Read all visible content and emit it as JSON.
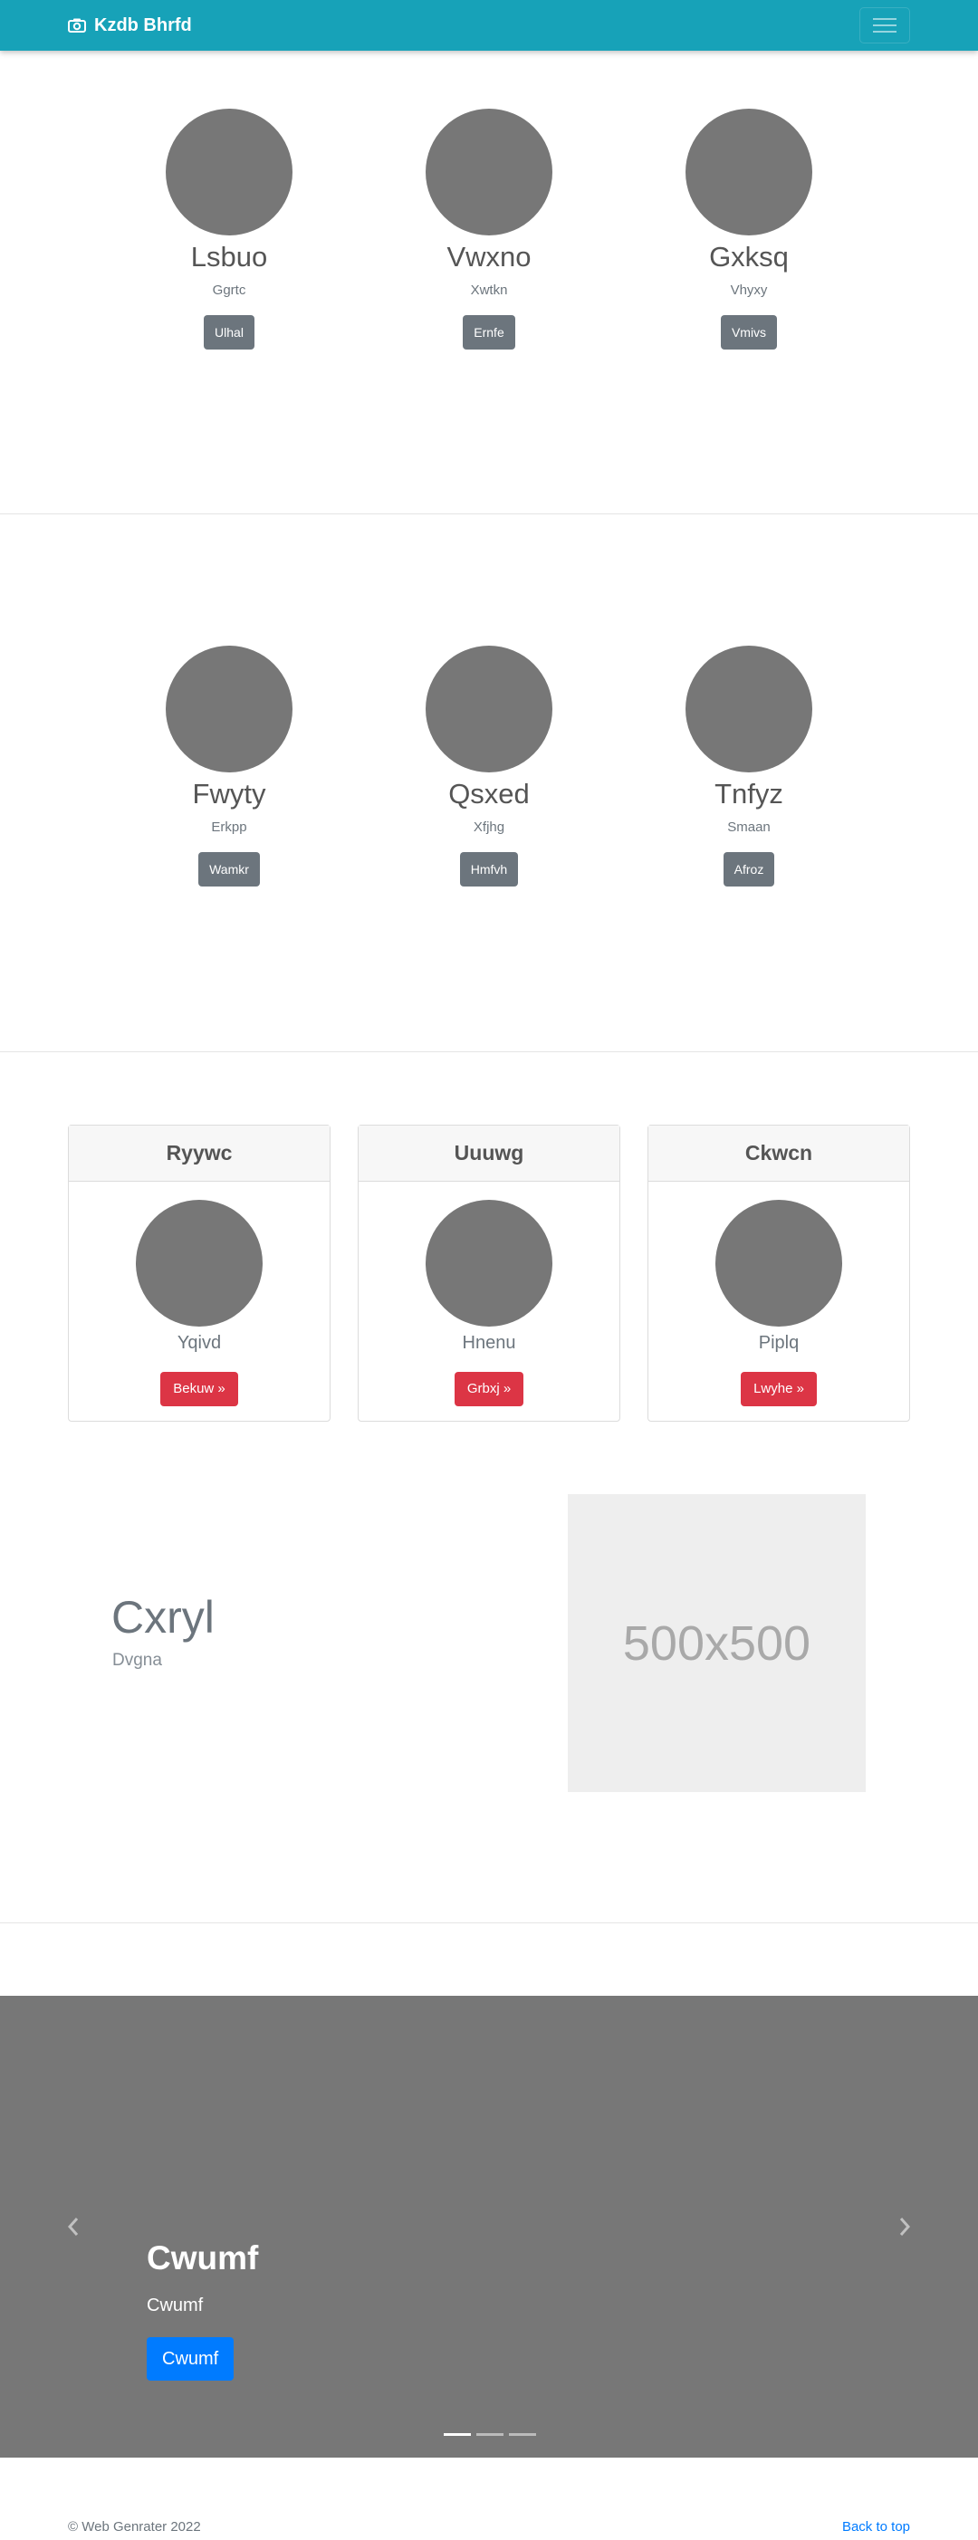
{
  "navbar": {
    "brand": "Kzdb Bhrfd",
    "brand_icon": "camera-icon",
    "toggler_icon": "hamburger-icon",
    "color": "#17a2b8"
  },
  "section1": {
    "profiles": [
      {
        "name": "Lsbuo",
        "sub": "Ggrtc",
        "button": "Ulhal"
      },
      {
        "name": "Vwxno",
        "sub": "Xwtkn",
        "button": "Ernfe"
      },
      {
        "name": "Gxksq",
        "sub": "Vhyxy",
        "button": "Vmivs"
      }
    ]
  },
  "section2": {
    "profiles": [
      {
        "name": "Fwyty",
        "sub": "Erkpp",
        "button": "Wamkr"
      },
      {
        "name": "Qsxed",
        "sub": "Xfjhg",
        "button": "Hmfvh"
      },
      {
        "name": "Tnfyz",
        "sub": "Smaan",
        "button": "Afroz"
      }
    ]
  },
  "cards": [
    {
      "header": "Ryywc",
      "name": "Yqivd",
      "button": "Bekuw »"
    },
    {
      "header": "Uuuwg",
      "name": "Hnenu",
      "button": "Grbxj »"
    },
    {
      "header": "Ckwcn",
      "name": "Piplq",
      "button": "Lwyhe »"
    }
  ],
  "feature": {
    "title": "Cxryl",
    "subtitle": "Dvgna",
    "image_label": "500x500"
  },
  "carousel": {
    "title": "Cwumf",
    "subtitle": "Cwumf",
    "button": "Cwumf",
    "active_index": 0,
    "slide_count": 3
  },
  "footer": {
    "copyright": "© Web Genrater 2022",
    "back_to_top": "Back to top"
  },
  "colors": {
    "danger": "#dc3545",
    "secondary": "#6c757d",
    "primary": "#007bff"
  }
}
